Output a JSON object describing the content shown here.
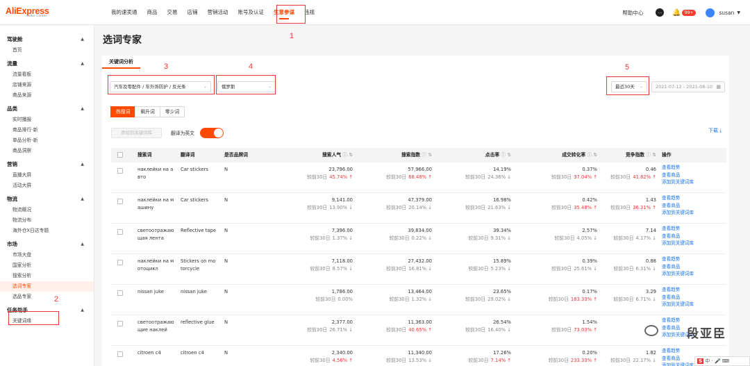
{
  "brand": {
    "logo": "AliExpress",
    "sub": "Seller Center"
  },
  "topnav": [
    {
      "label": "我的速卖通",
      "active": false
    },
    {
      "label": "商品",
      "active": false
    },
    {
      "label": "交易",
      "active": false
    },
    {
      "label": "店铺",
      "active": false
    },
    {
      "label": "营销活动",
      "active": false
    },
    {
      "label": "账号及认证",
      "active": false
    },
    {
      "label": "生意参谋",
      "active": true
    },
    {
      "label": "违规",
      "active": false
    }
  ],
  "topright": {
    "help": "帮助中心",
    "badge": "99+",
    "user": "susan"
  },
  "sidebar": {
    "groups": [
      {
        "label": "驾驶舱",
        "items": [
          "首页"
        ]
      },
      {
        "label": "流量",
        "items": [
          "流量看板",
          "店铺来源",
          "商品来源"
        ]
      },
      {
        "label": "品类",
        "items": [
          "实时播报",
          "商品排行-新",
          "单品分析-新",
          "商品洞察"
        ]
      },
      {
        "label": "营销",
        "items": [
          "直播大屏",
          "活动大屏"
        ]
      },
      {
        "label": "物流",
        "items": [
          "物流概况",
          "物流分布",
          "海外仓X日达专题"
        ]
      },
      {
        "label": "市场",
        "items": [
          "市场大盘",
          "国家分析",
          "搜索分析",
          "选词专家",
          "选品专家"
        ]
      },
      {
        "label": "任务助手",
        "items": [
          "关键词缘"
        ]
      }
    ],
    "active_item": "选词专家"
  },
  "page": {
    "title": "选词专家",
    "tab": "关键词分析"
  },
  "filters": {
    "category": "汽车及零配件 / 车外饰防护 / 反光条",
    "country": "俄罗斯",
    "period": "最近30天",
    "date_range": "2021-07-12 - 2021-08-10"
  },
  "segments": [
    {
      "label": "热搜词",
      "active": true
    },
    {
      "label": "飙升词",
      "active": false
    },
    {
      "label": "零少词",
      "active": false
    }
  ],
  "actions": {
    "add_btn": "添加到关键词库",
    "translate_label": "翻译为英文",
    "translate_on": true,
    "download": "下载"
  },
  "annotations": [
    "1",
    "2",
    "3",
    "4",
    "5"
  ],
  "table": {
    "columns": [
      "搜索词",
      "翻译词",
      "是否品牌词",
      "搜索人气",
      "搜索指数",
      "点击率",
      "成交转化率",
      "竞争指数",
      "操作"
    ],
    "compare_label": "较前30日",
    "ops": [
      "查看趋势",
      "查看商品",
      "添加到关键词库"
    ],
    "rows": [
      {
        "kw": [
          "наклейки на а",
          "вто"
        ],
        "tr": [
          "Car stickers"
        ],
        "brand": "N",
        "pop": "23,796.00",
        "pop_c": "45.74%",
        "pop_d": "up",
        "idx": "57,966.00",
        "idx_c": "68.48%",
        "idx_d": "up",
        "ctr": "14.19%",
        "ctr_c": "24.36%",
        "ctr_d": "down",
        "cvr": "0.37%",
        "cvr_c": "37.04%",
        "cvr_d": "up",
        "comp": "0.46",
        "comp_c": "41.82%",
        "comp_d": "up"
      },
      {
        "kw": [
          "наклейки на м",
          "ашину"
        ],
        "tr": [
          "Car stickers"
        ],
        "brand": "N",
        "pop": "9,141.00",
        "pop_c": "13.90%",
        "pop_d": "down",
        "idx": "47,379.00",
        "idx_c": "20.14%",
        "idx_d": "down",
        "ctr": "16.98%",
        "ctr_c": "21.63%",
        "ctr_d": "down",
        "cvr": "0.42%",
        "cvr_c": "35.48%",
        "cvr_d": "up",
        "comp": "1.43",
        "comp_c": "36.31%",
        "comp_d": "up"
      },
      {
        "kw": [
          "светоотражаю",
          "щая лента"
        ],
        "tr": [
          "Reflective tape"
        ],
        "brand": "N",
        "pop": "7,396.00",
        "pop_c": "1.37%",
        "pop_d": "down",
        "idx": "39,834.00",
        "idx_c": "0.22%",
        "idx_d": "down",
        "ctr": "39.34%",
        "ctr_c": "9.31%",
        "ctr_d": "down",
        "cvr": "2.57%",
        "cvr_c": "4.05%",
        "cvr_d": "down",
        "comp": "7.14",
        "comp_c": "4.17%",
        "comp_d": "down"
      },
      {
        "kw": [
          "наклейки на м",
          "отоцикл"
        ],
        "tr": [
          "Stickers on mo",
          "torcycle"
        ],
        "brand": "N",
        "pop": "7,118.00",
        "pop_c": "8.57%",
        "pop_d": "down",
        "idx": "27,432.00",
        "idx_c": "16.81%",
        "idx_d": "down",
        "ctr": "15.89%",
        "ctr_c": "5.23%",
        "ctr_d": "down",
        "cvr": "0.39%",
        "cvr_c": "25.61%",
        "cvr_d": "down",
        "comp": "0.88",
        "comp_c": "6.31%",
        "comp_d": "down"
      },
      {
        "kw": [
          "nissan juke"
        ],
        "tr": [
          "nissan juke"
        ],
        "brand": "N",
        "pop": "1,786.00",
        "pop_c": "0.00%",
        "pop_d": "none",
        "idx": "13,464.00",
        "idx_c": "1.32%",
        "idx_d": "down",
        "ctr": "23.65%",
        "ctr_c": "29.02%",
        "ctr_d": "down",
        "cvr": "0.17%",
        "cvr_c": "183.33%",
        "cvr_d": "up",
        "comp": "3.29",
        "comp_c": "6.71%",
        "comp_d": "down"
      },
      {
        "kw": [
          "светоотражаю",
          "щие наклей"
        ],
        "tr": [
          "reflective glue"
        ],
        "brand": "N",
        "pop": "2,377.00",
        "pop_c": "26.71%",
        "pop_d": "down",
        "idx": "11,363.00",
        "idx_c": "40.65%",
        "idx_d": "up",
        "ctr": "26.54%",
        "ctr_c": "16.40%",
        "ctr_d": "down",
        "cvr": "1.54%",
        "cvr_c": "73.03%",
        "cvr_d": "up",
        "comp": "",
        "comp_c": "",
        "comp_d": "none"
      },
      {
        "kw": [
          "citroen c4"
        ],
        "tr": [
          "citroen c4"
        ],
        "brand": "N",
        "pop": "2,340.00",
        "pop_c": "4.56%",
        "pop_d": "up",
        "idx": "11,340.00",
        "idx_c": "13.53%",
        "idx_d": "down",
        "ctr": "17.26%",
        "ctr_c": "7.14%",
        "ctr_d": "up",
        "cvr": "0.20%",
        "cvr_c": "233.33%",
        "cvr_d": "up",
        "comp": "1.82",
        "comp_c": "22.17%",
        "comp_d": "down"
      }
    ]
  },
  "watermark": "段亚臣"
}
